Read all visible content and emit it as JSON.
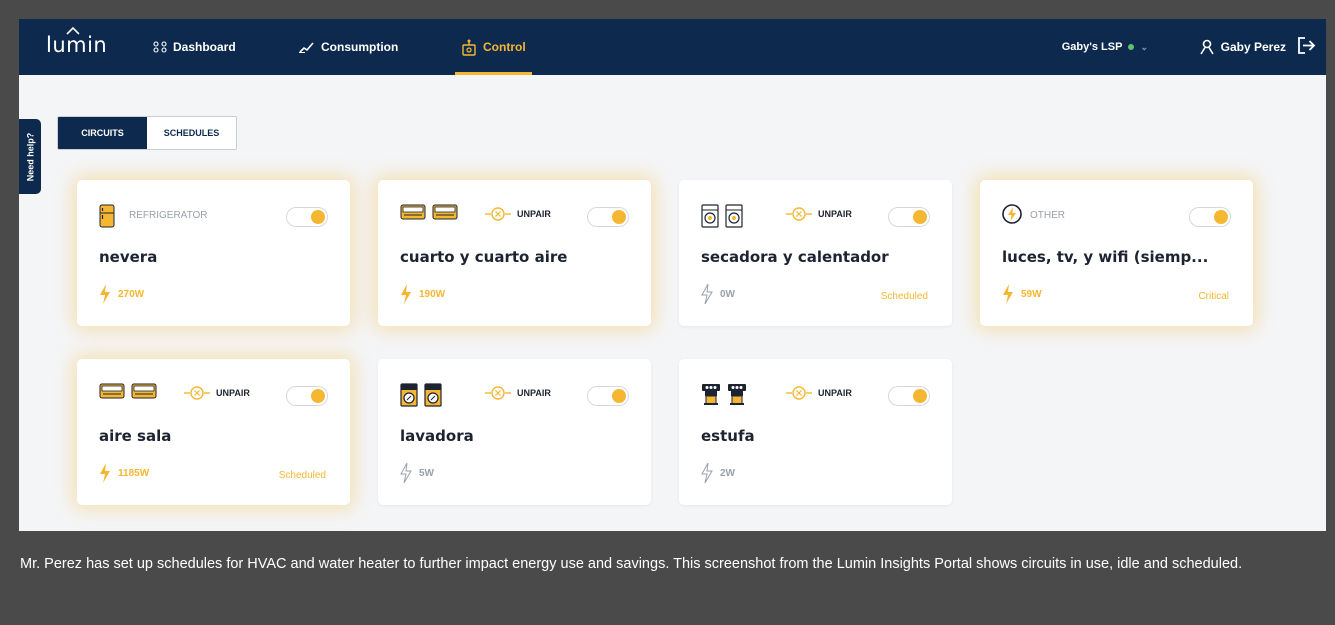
{
  "app": {
    "logo": "lumin",
    "nav": [
      {
        "label": "Dashboard",
        "icon": "dashboard-icon"
      },
      {
        "label": "Consumption",
        "icon": "consumption-icon"
      },
      {
        "label": "Control",
        "icon": "control-icon",
        "active": true
      }
    ],
    "site": "Gaby's LSP",
    "user": "Gaby Perez",
    "help": "Need help?",
    "accent_color": "#f5b731",
    "nav_color": "#0d2a4e"
  },
  "tabs": [
    {
      "label": "CIRCUITS",
      "active": true
    },
    {
      "label": "SCHEDULES",
      "active": false
    }
  ],
  "unpair_label": "UNPAIR",
  "circuits": [
    {
      "type": "REFRIGERATOR",
      "name": "nevera",
      "power": "270W",
      "status": "",
      "active": true,
      "icon": "refrigerator-icon",
      "on": true
    },
    {
      "type": "",
      "name": "cuarto y cuarto aire",
      "power": "190W",
      "status": "",
      "active": true,
      "icon": "air-conditioner-icon",
      "on": true
    },
    {
      "type": "",
      "name": "secadora y calentador",
      "power": "0W",
      "status": "Scheduled",
      "active": false,
      "icon": "washer-dryer-icon",
      "on": true
    },
    {
      "type": "OTHER",
      "name": "luces, tv, y wifi (siemp...",
      "power": "59W",
      "status": "Critical",
      "active": true,
      "icon": "lightning-icon",
      "on": true
    },
    {
      "type": "",
      "name": "aire sala",
      "power": "1185W",
      "status": "Scheduled",
      "active": true,
      "icon": "air-conditioner-icon",
      "on": true
    },
    {
      "type": "",
      "name": "lavadora",
      "power": "5W",
      "status": "",
      "active": false,
      "icon": "washing-machine-icon",
      "on": true
    },
    {
      "type": "",
      "name": "estufa",
      "power": "2W",
      "status": "",
      "active": false,
      "icon": "coffee-maker-icon",
      "on": true
    }
  ],
  "caption": "Mr. Perez has set up schedules for HVAC and water heater to further impact energy use and savings. This screenshot from the Lumin Insights Portal shows circuits in use, idle and scheduled."
}
